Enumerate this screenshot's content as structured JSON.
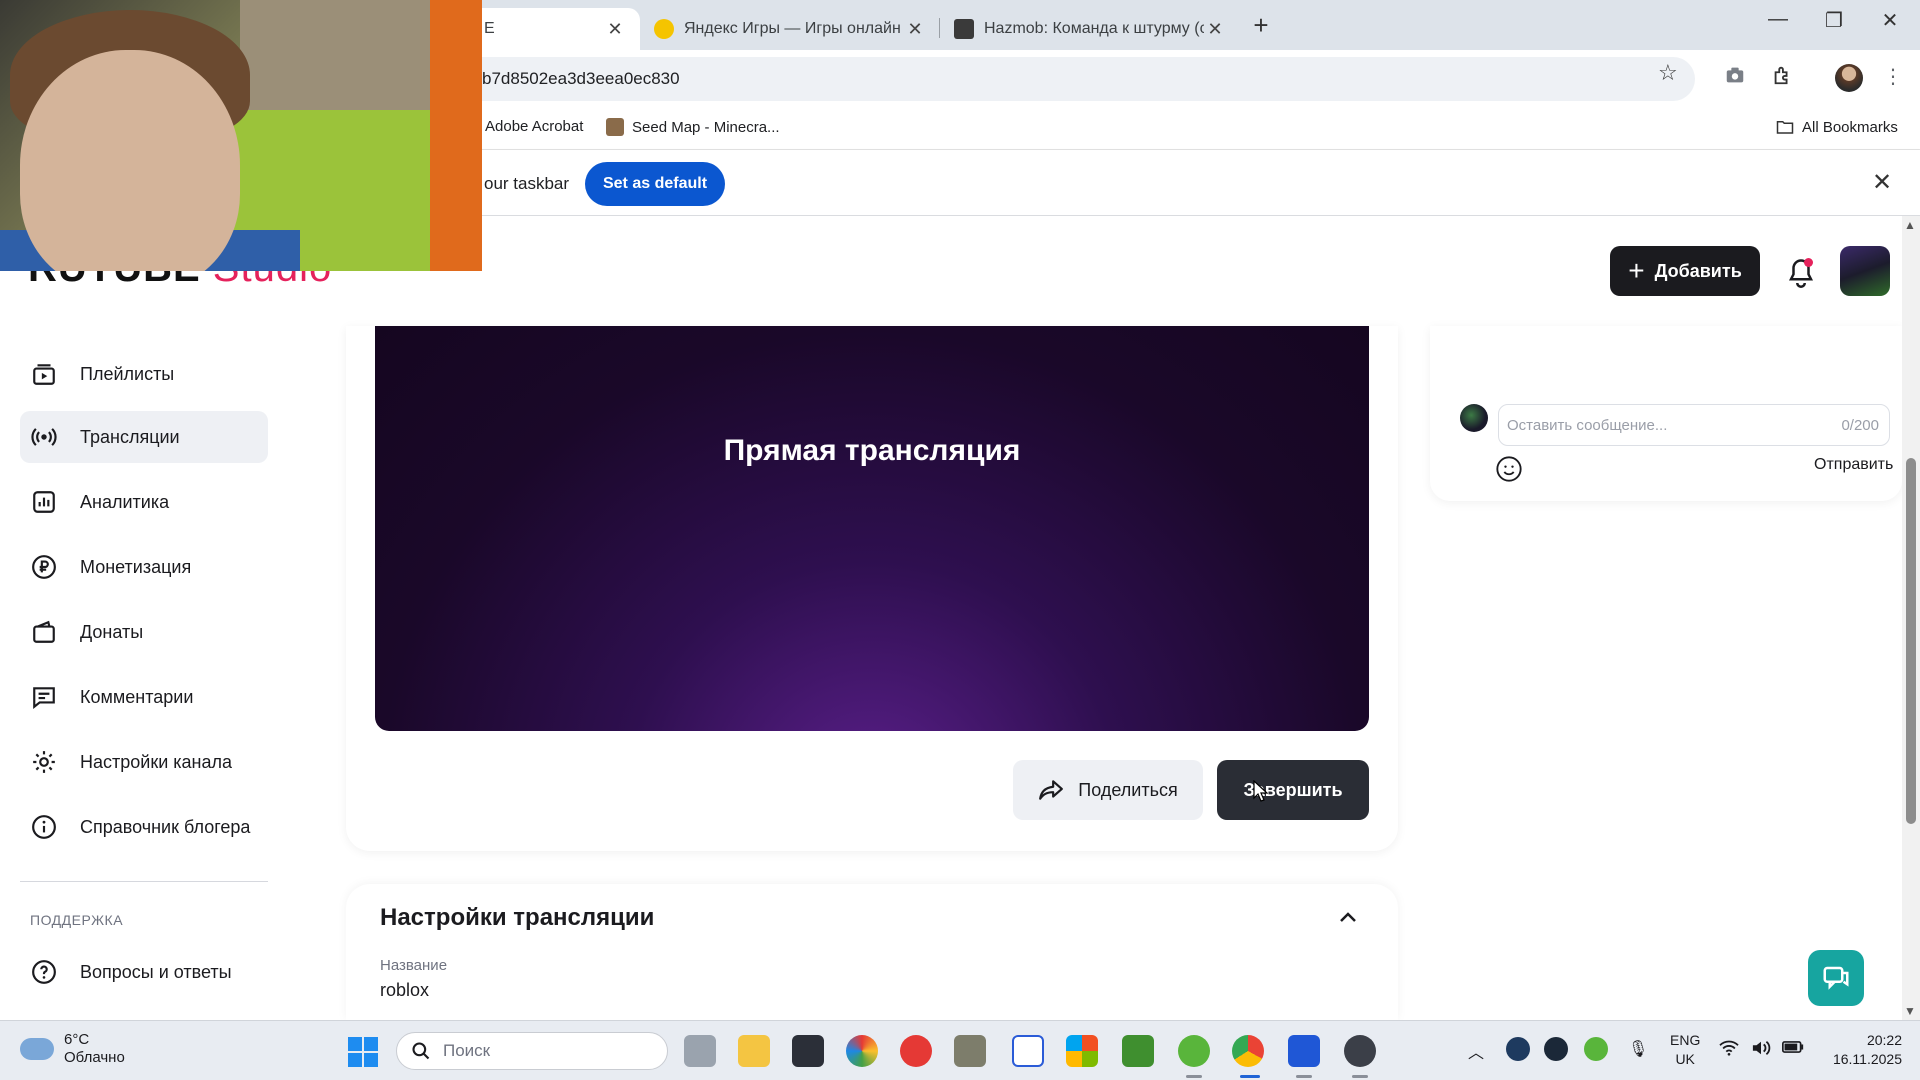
{
  "browser": {
    "tabs": [
      {
        "title": "E",
        "active": true
      },
      {
        "title": "Яндекс Игры — Игры онлайн",
        "active": false
      },
      {
        "title": "Hazmob: Команда к штурму (с",
        "active": false
      }
    ],
    "url": "b7d8502ea3d3eea0ec830",
    "bookmarks": [
      "Adobe Acrobat",
      "Seed Map - Minecra..."
    ],
    "all_bookmarks": "All Bookmarks",
    "infobar": {
      "message": "our taskbar",
      "set_default_label": "Set as default"
    }
  },
  "header": {
    "logo_main": "RUTUBE",
    "logo_studio": "Studio",
    "add_label": "Добавить"
  },
  "sidebar": {
    "items": [
      {
        "label": "Плейлисты",
        "icon": "playlist-icon",
        "active": false
      },
      {
        "label": "Трансляции",
        "icon": "broadcast-icon",
        "active": true
      },
      {
        "label": "Аналитика",
        "icon": "analytics-icon",
        "active": false
      },
      {
        "label": "Монетизация",
        "icon": "ruble-icon",
        "active": false
      },
      {
        "label": "Донаты",
        "icon": "wallet-icon",
        "active": false
      },
      {
        "label": "Комментарии",
        "icon": "comment-icon",
        "active": false
      },
      {
        "label": "Настройки канала",
        "icon": "gear-icon",
        "active": false
      },
      {
        "label": "Справочник блогера",
        "icon": "info-icon",
        "active": false
      }
    ],
    "support_heading": "ПОДДЕРЖКА",
    "support_items": [
      {
        "label": "Вопросы и ответы",
        "icon": "question-icon"
      }
    ]
  },
  "player": {
    "title": "Прямая трансляция"
  },
  "actions": {
    "share_label": "Поделиться",
    "finish_label": "Завершить"
  },
  "settings": {
    "title": "Настройки трансляции",
    "name_label": "Название",
    "name_value": "roblox"
  },
  "chat": {
    "placeholder": "Оставить сообщение...",
    "counter": "0/200",
    "send_label": "Отправить"
  },
  "taskbar": {
    "weather_temp": "6°C",
    "weather_cond": "Облачно",
    "search_placeholder": "Поиск",
    "lang_top": "ENG",
    "lang_bottom": "UK",
    "time": "20:22",
    "date": "16.11.2025"
  },
  "colors": {
    "accent_red": "#e5225c",
    "dark_button": "#1b1b1f",
    "chrome_blue": "#0b57d0",
    "help_teal": "#17a5a0"
  }
}
